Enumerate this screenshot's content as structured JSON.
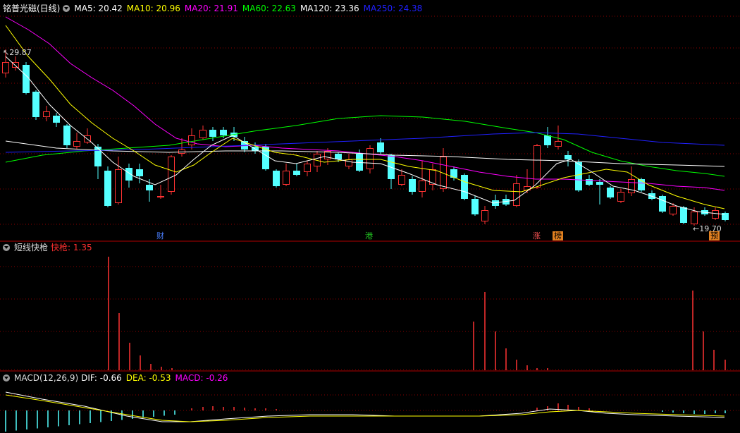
{
  "main_panel": {
    "stock_name": "铭普光磁(日线)",
    "ma": [
      {
        "label": "MA5: 20.42",
        "color": "#ffffff"
      },
      {
        "label": "MA10: 20.96",
        "color": "#ffff00"
      },
      {
        "label": "MA20: 21.91",
        "color": "#ff00ff"
      },
      {
        "label": "MA60: 22.63",
        "color": "#00ff00"
      },
      {
        "label": "MA120: 23.36",
        "color": "#ffffff"
      },
      {
        "label": "MA250: 24.38",
        "color": "#2020ff"
      }
    ],
    "high_label": "29.87",
    "low_label": "19.70",
    "markers": [
      {
        "text": "财",
        "color": "#4a7fff"
      },
      {
        "text": "港",
        "color": "#22c522"
      },
      {
        "text": "涨",
        "color": "#ff5555"
      },
      {
        "text": "榜",
        "color": "#e08020"
      },
      {
        "text": "预",
        "color": "#e08020"
      }
    ]
  },
  "indicator_panel": {
    "title": "短线快枪",
    "value_label": "快枪: 1.35",
    "value_color": "#ff3030"
  },
  "macd_panel": {
    "title": "MACD(12,26,9)",
    "dif": "DIF: -0.66",
    "dea": "DEA: -0.53",
    "macd": "MACD: -0.26"
  },
  "colors": {
    "up": "#ff3232",
    "down": "#54ffff",
    "grid": "#8b0000",
    "ma5": "#ffffff",
    "ma10": "#ffff00",
    "ma20": "#ff00ff",
    "ma60": "#00ff00",
    "ma120": "#ffffff",
    "ma250": "#2020ff"
  }
}
